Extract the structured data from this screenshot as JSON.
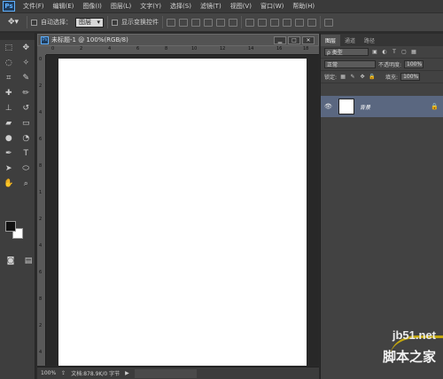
{
  "menubar": {
    "logo": "Ps",
    "items": [
      "文件(F)",
      "编辑(E)",
      "图像(I)",
      "图层(L)",
      "文字(Y)",
      "选择(S)",
      "滤镜(T)",
      "视图(V)",
      "窗口(W)",
      "帮助(H)"
    ]
  },
  "options": {
    "auto_select_label": "自动选择：",
    "auto_select_value": "图层",
    "show_transform_label": "显示变换控件"
  },
  "document": {
    "title": "未标题-1 @ 100%(RGB/8)",
    "ruler_top": [
      "0",
      "2",
      "4",
      "6",
      "8",
      "10",
      "12",
      "14",
      "16",
      "18"
    ],
    "ruler_left": [
      "0",
      "2",
      "4",
      "6",
      "8",
      "1",
      "2",
      "4",
      "6",
      "8",
      "2",
      "4"
    ],
    "zoom": "100%",
    "doc_info": "文档:878.9K/0 字节"
  },
  "layers_panel": {
    "tabs": [
      "图层",
      "通道",
      "路径"
    ],
    "filter_label": "ρ 类型",
    "blend_mode": "正常",
    "opacity_label": "不透明度:",
    "opacity_value": "100%",
    "lock_label": "锁定:",
    "fill_label": "填充:",
    "fill_value": "100%",
    "layer_name": "背景"
  },
  "watermark": {
    "line1": "jb51.net",
    "line2": "脚本之家"
  }
}
